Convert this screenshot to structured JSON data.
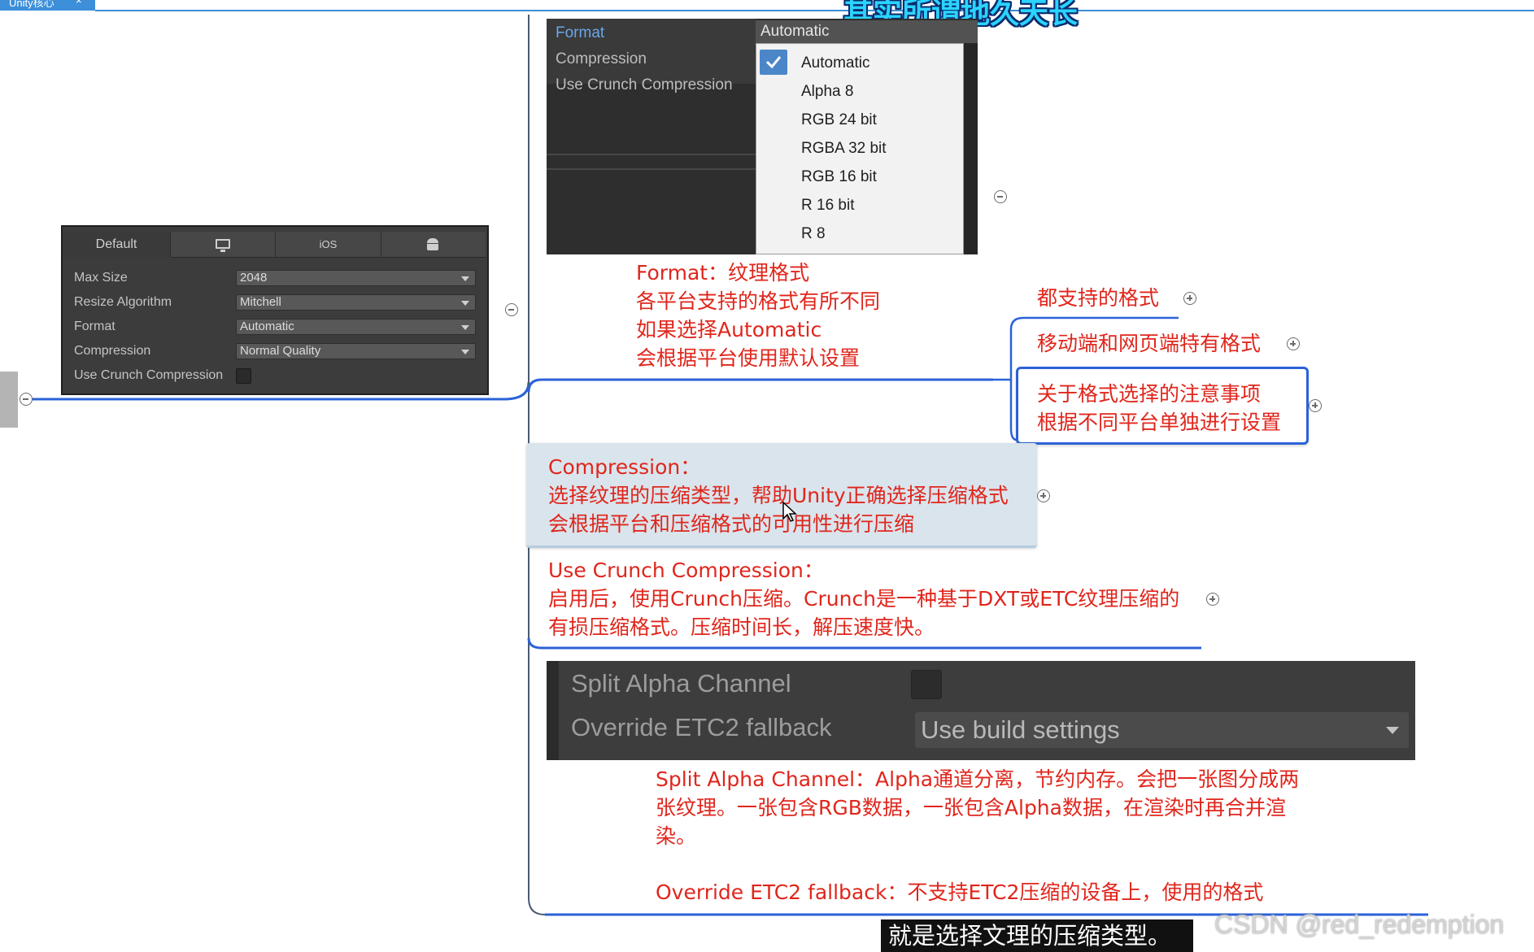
{
  "window_tab": {
    "label": "Unity核心",
    "close_glyph": "×"
  },
  "caption_top": "其实所谓地久天长",
  "inspector": {
    "tabs": [
      {
        "label": "Default"
      },
      {
        "icon": "monitor-icon"
      },
      {
        "label": "iOS"
      },
      {
        "icon": "android-icon"
      }
    ],
    "rows": [
      {
        "label": "Max Size",
        "value": "2048"
      },
      {
        "label": "Resize Algorithm",
        "value": "Mitchell"
      },
      {
        "label": "Format",
        "value": "Automatic"
      },
      {
        "label": "Compression",
        "value": "Normal Quality"
      }
    ],
    "crunch_label": "Use Crunch Compression",
    "crunch_checked": false
  },
  "format_menu": {
    "labels": [
      "Format",
      "Compression",
      "Use Crunch Compression"
    ],
    "selected": "Automatic",
    "options": [
      "Automatic",
      "Alpha 8",
      "RGB 24 bit",
      "RGBA 32 bit",
      "RGB 16 bit",
      "R 16 bit",
      "R 8"
    ],
    "checked_index": 0
  },
  "mindmap": {
    "format_note": [
      "Format：纹理格式",
      "各平台支持的格式有所不同",
      "如果选择Automatic",
      "会根据平台使用默认设置"
    ],
    "format_children": [
      "都支持的格式",
      "移动端和网页端特有格式"
    ],
    "format_highlight": [
      "关于格式选择的注意事项",
      "根据不同平台单独进行设置"
    ],
    "compression_note": [
      "Compression：",
      "选择纹理的压缩类型，帮助Unity正确选择压缩格式",
      "会根据平台和压缩格式的可用性进行压缩"
    ],
    "crunch_note": [
      "Use Crunch Compression：",
      "启用后，使用Crunch压缩。Crunch是一种基于DXT或ETC纹理压缩的",
      "有损压缩格式。压缩时间长，解压速度快。"
    ],
    "split_alpha_note": [
      "Split Alpha Channel：Alpha通道分离，节约内存。会把一张图分成两",
      "张纹理。一张包含RGB数据，一张包含Alpha数据，在渲染时再合并渲",
      "染。"
    ],
    "etc2_note": "Override ETC2 fallback：不支持ETC2压缩的设备上，使用的格式"
  },
  "split_panel": {
    "split_label": "Split Alpha Channel",
    "split_checked": false,
    "override_label": "Override ETC2 fallback",
    "override_value": "Use build settings"
  },
  "subtitle": "就是选择文理的压缩类型。",
  "watermark": "CSDN @red_redemption",
  "colors": {
    "note_red": "#e0261c",
    "branch_blue": "#2b62d8",
    "caption_cyan": "#2ad4ff",
    "unity_panel": "#3c3c3c"
  }
}
